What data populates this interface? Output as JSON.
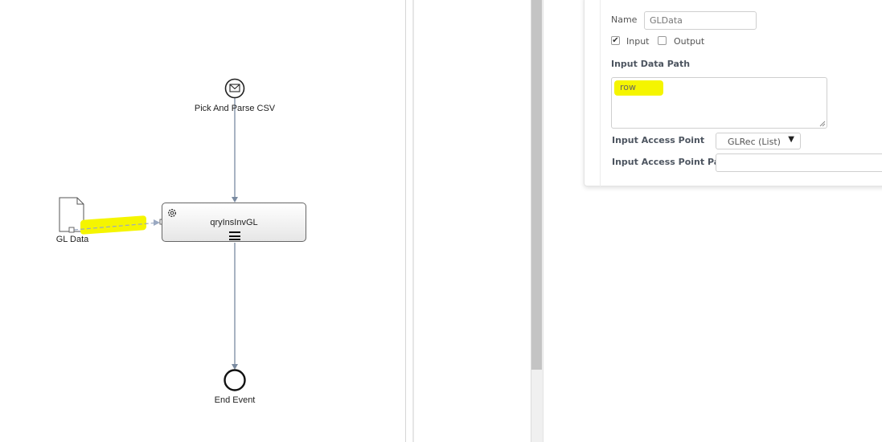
{
  "diagram": {
    "start_event_label": "Pick And Parse CSV",
    "task_label": "qryInsInvGL",
    "data_object_label": "GL Data",
    "end_event_label": "End Event",
    "icons": {
      "start": "envelope-icon",
      "task": "gear-icon",
      "task_marker": "multi-instance-icon",
      "data": "document-icon"
    },
    "colors": {
      "flow": "#7a8aa0",
      "highlight": "#f5f500"
    }
  },
  "properties": {
    "name_label": "Name",
    "name_value": "GLData",
    "input_label": "Input",
    "input_checked": true,
    "output_label": "Output",
    "output_checked": false,
    "input_data_path_label": "Input Data Path",
    "input_data_path_value": "row",
    "input_access_point_label": "Input Access Point",
    "input_access_point_value": "GLRec (List)",
    "input_access_point_path_label": "Input Access Point Path",
    "input_access_point_path_value": ""
  }
}
